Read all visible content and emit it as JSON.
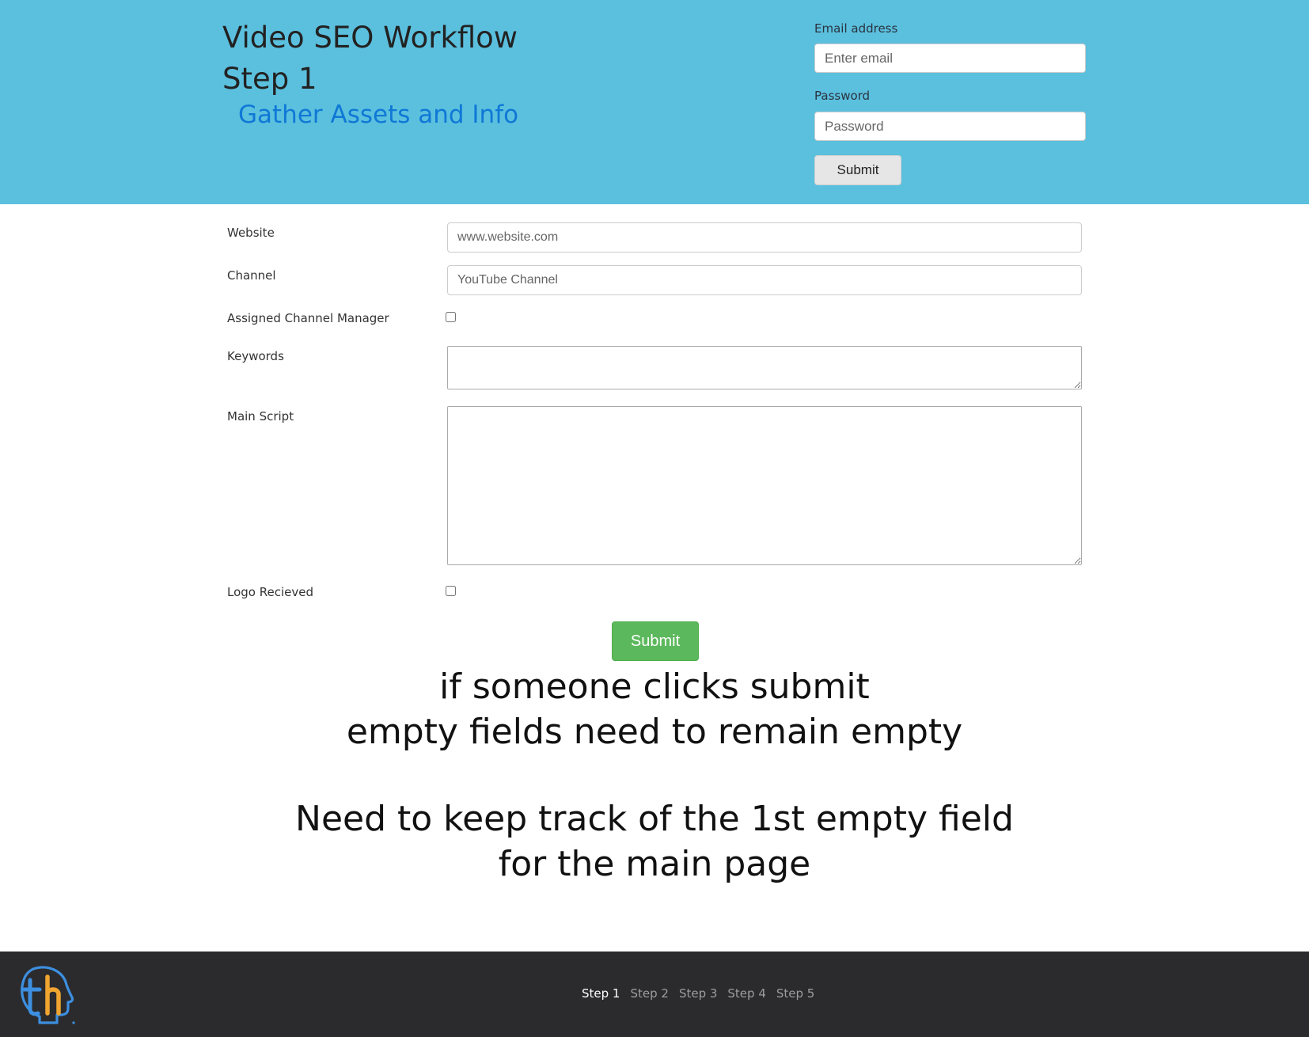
{
  "header": {
    "title_line1": "Video SEO Workflow",
    "title_line2": "Step 1",
    "subtitle": "Gather Assets and Info",
    "background_color": "#5bc0de",
    "subtitle_color": "#0f78d6"
  },
  "login": {
    "email_label": "Email address",
    "email_placeholder": "Enter email",
    "password_label": "Password",
    "password_placeholder": "Password",
    "submit_label": "Submit"
  },
  "form": {
    "website_label": "Website",
    "website_placeholder": "www.website.com",
    "channel_label": "Channel",
    "channel_placeholder": "YouTube Channel",
    "channel_manager_label": "Assigned Channel Manager",
    "channel_manager_checked": false,
    "keywords_label": "Keywords",
    "main_script_label": "Main Script",
    "logo_label": "Logo Recieved",
    "logo_checked": false,
    "submit_label": "Submit",
    "submit_color": "#5cb85c"
  },
  "notes": {
    "line1": "if someone clicks submit",
    "line2": "empty fields need to remain empty",
    "line3": "Need to keep track of the 1st empty field",
    "line4": "for the main page"
  },
  "footer": {
    "logo_icon": "th-head-logo",
    "background_color": "#2b2b2e",
    "steps": [
      "Step 1",
      "Step 2",
      "Step 3",
      "Step 4",
      "Step 5"
    ],
    "active_step": "Step 1"
  }
}
